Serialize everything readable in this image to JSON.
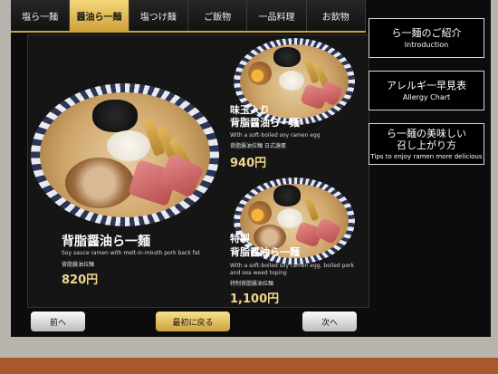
{
  "tabs": [
    {
      "label": "塩ら一麺",
      "active": false
    },
    {
      "label": "醤油ら一麺",
      "active": true
    },
    {
      "label": "塩つけ麺",
      "active": false
    },
    {
      "label": "ご飯物",
      "active": false
    },
    {
      "label": "一品料理",
      "active": false
    },
    {
      "label": "お飲物",
      "active": false
    }
  ],
  "side_buttons": [
    {
      "jp": "ら一麺のご紹介",
      "en": "Introduction"
    },
    {
      "jp": "アレルギ一早見表",
      "en": "Allergy Chart"
    },
    {
      "jp_line1": "ら一麺の美味しい",
      "jp_line2": "召し上がり方",
      "en": "Tips to enjoy ramen more delicious"
    }
  ],
  "items": [
    {
      "title": "背脂醤油ら一麺",
      "desc": "Soy sauce ramen with melt-in-mouth pork back fat",
      "sub_jp": "背脂醤油拉麺",
      "price": "820円"
    },
    {
      "title_line1": "味玉入り",
      "title_line2": "背脂醤油ら一麺",
      "desc": "With a soft-boiled soy ramen egg",
      "sub_jp": "背脂醤油拉麺 日式溏蛋",
      "price": "940円"
    },
    {
      "title_line1": "特製",
      "title_line2": "背脂醤油ら一麺",
      "desc": "With a soft-boiled soy ramen egg, boiled pork and sea weed toping",
      "sub_jp": "特制背脂醤油拉麺",
      "price": "1,100円"
    }
  ],
  "nav": {
    "prev": "前へ",
    "home": "最初に戻る",
    "next": "次へ"
  },
  "colors": {
    "accent_gold": "#cfa33c",
    "price_gold": "#f2d78a",
    "screen_bg": "#0c0c0c"
  }
}
